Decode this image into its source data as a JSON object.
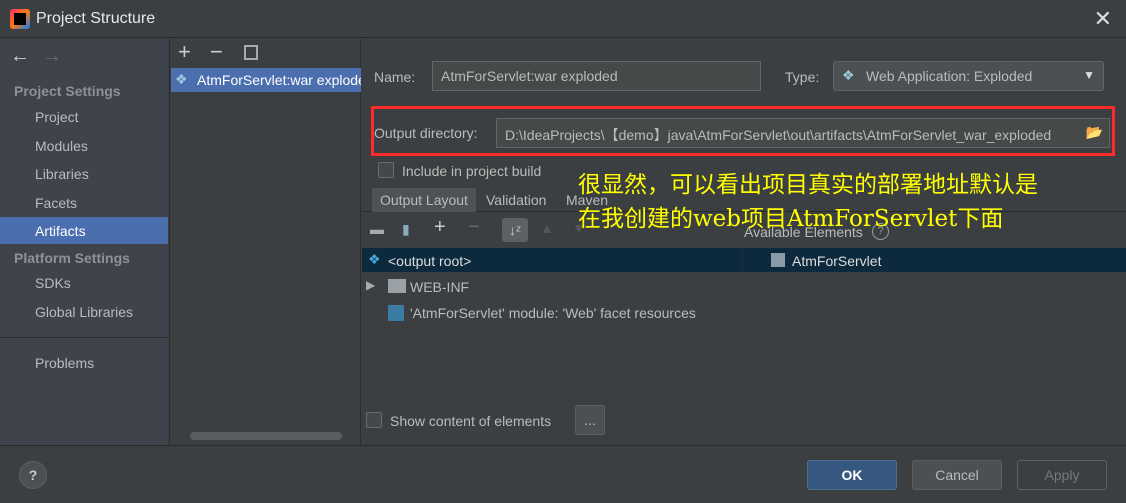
{
  "window": {
    "title": "Project Structure"
  },
  "sidebar": {
    "section1": "Project Settings",
    "items1": [
      "Project",
      "Modules",
      "Libraries",
      "Facets",
      "Artifacts"
    ],
    "section2": "Platform Settings",
    "items2": [
      "SDKs",
      "Global Libraries"
    ],
    "problems": "Problems",
    "selected": "Artifacts"
  },
  "artifacts": {
    "items": [
      "AtmForServlet:war exploded"
    ]
  },
  "form": {
    "name_label": "Name:",
    "name_value": "AtmForServlet:war exploded",
    "type_label": "Type:",
    "type_value": "Web Application: Exploded",
    "output_label": "Output directory:",
    "output_value": "D:\\IdeaProjects\\【demo】java\\AtmForServlet\\out\\artifacts\\AtmForServlet_war_exploded",
    "include_label": "Include in project build"
  },
  "tabs": [
    "Output Layout",
    "Validation",
    "Maven"
  ],
  "layout": {
    "available_label": "Available Elements",
    "tree": [
      "<output root>",
      "WEB-INF",
      "'AtmForServlet' module: 'Web' facet resources"
    ],
    "available": [
      "AtmForServlet"
    ],
    "show_content_label": "Show content of elements",
    "more_label": "..."
  },
  "annotation": {
    "line1": "很显然，可以看出项目真实的部署地址默认是",
    "line2": "在我创建的web项目AtmForServlet下面"
  },
  "footer": {
    "help": "?",
    "ok": "OK",
    "cancel": "Cancel",
    "apply": "Apply"
  },
  "colors": {
    "selection": "#4b6eaf",
    "highlight_box": "#ff2a2a",
    "annotation": "#ffff00"
  }
}
